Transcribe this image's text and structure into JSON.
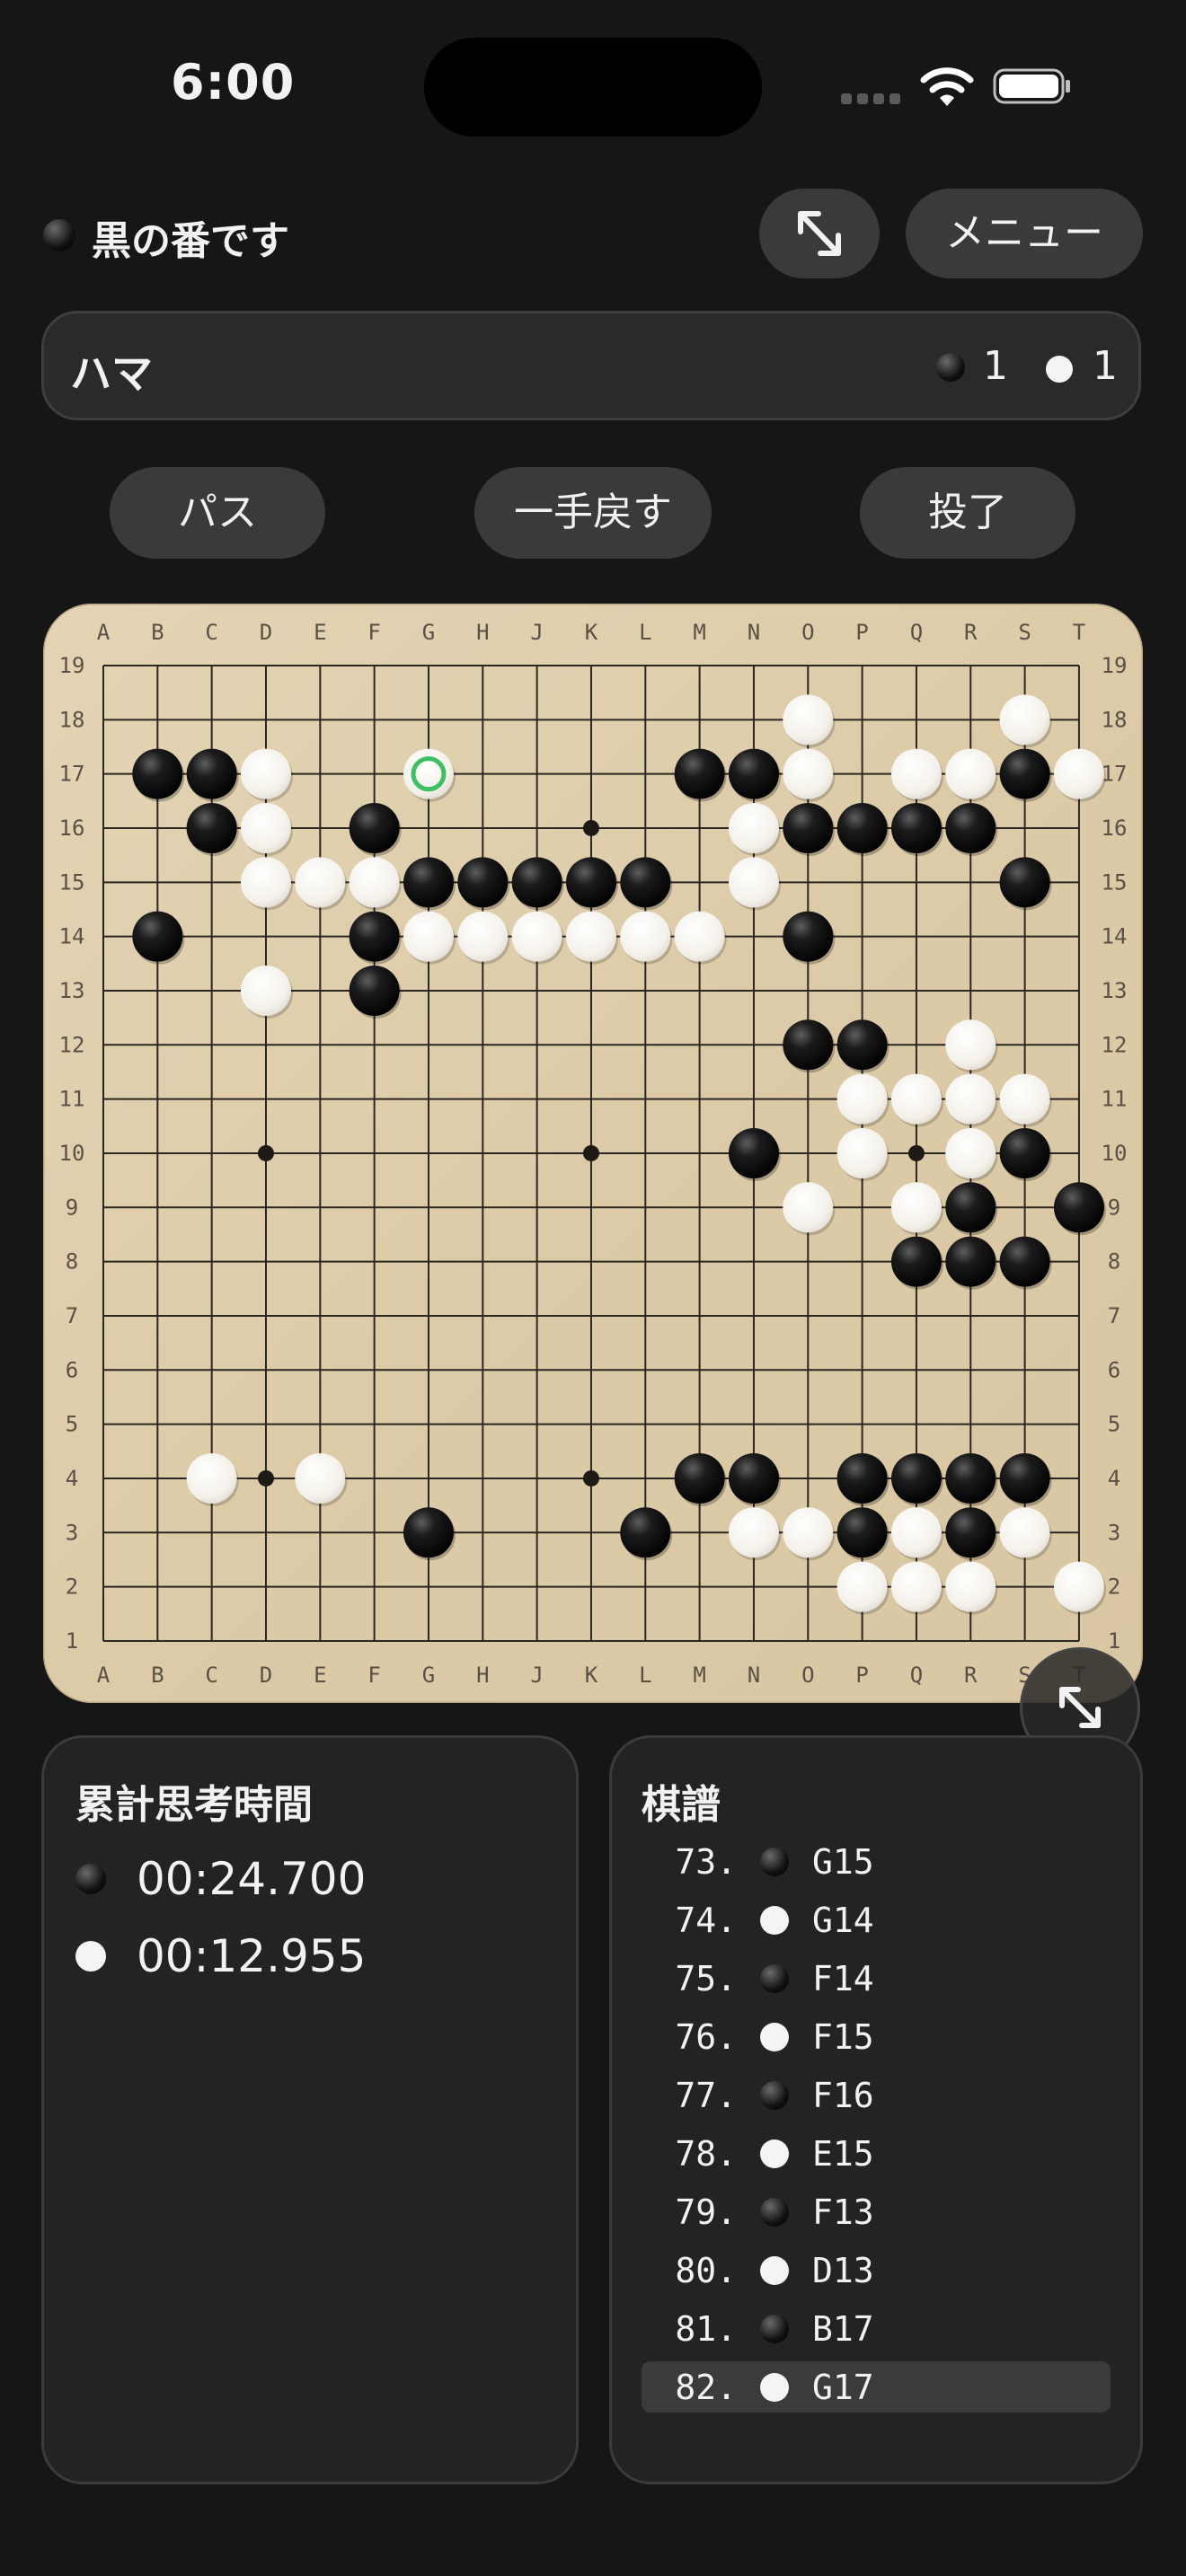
{
  "status_bar": {
    "time": "6:00"
  },
  "header": {
    "turn_text": "黒の番です",
    "turn_color": "black",
    "menu_label": "メニュー"
  },
  "hama": {
    "label": "ハマ",
    "black": "1",
    "white": "1"
  },
  "actions": {
    "pass": "パス",
    "undo": "一手戻す",
    "resign": "投了"
  },
  "board": {
    "size": 19,
    "columns": [
      "A",
      "B",
      "C",
      "D",
      "E",
      "F",
      "G",
      "H",
      "J",
      "K",
      "L",
      "M",
      "N",
      "O",
      "P",
      "Q",
      "R",
      "S",
      "T"
    ],
    "rows": [
      "19",
      "18",
      "17",
      "16",
      "15",
      "14",
      "13",
      "12",
      "11",
      "10",
      "9",
      "8",
      "7",
      "6",
      "5",
      "4",
      "3",
      "2",
      "1"
    ],
    "star_points": [
      "D16",
      "K16",
      "Q16",
      "D10",
      "K10",
      "Q10",
      "D4",
      "K4",
      "Q4"
    ],
    "last_move": "G17",
    "last_move_marker_color": "#3cc061",
    "black_stones": [
      "B17",
      "C17",
      "M17",
      "N17",
      "S17",
      "C16",
      "F16",
      "O16",
      "P16",
      "Q16",
      "R16",
      "G15",
      "H15",
      "J15",
      "K15",
      "L15",
      "S15",
      "B14",
      "F14",
      "O14",
      "F13",
      "O12",
      "P12",
      "S10",
      "N10",
      "R9",
      "T9",
      "Q8",
      "R8",
      "S8",
      "M4",
      "N4",
      "P4",
      "Q4",
      "R4",
      "S4",
      "G3",
      "L3",
      "P3",
      "R3"
    ],
    "white_stones": [
      "O18",
      "S18",
      "D17",
      "G17",
      "O17",
      "Q17",
      "R17",
      "T17",
      "D16",
      "N16",
      "D15",
      "E15",
      "F15",
      "N15",
      "G14",
      "H14",
      "J14",
      "K14",
      "L14",
      "M14",
      "D13",
      "R12",
      "P11",
      "Q11",
      "R11",
      "S11",
      "P10",
      "R10",
      "O9",
      "Q9",
      "C4",
      "E4",
      "N3",
      "O3",
      "Q3",
      "S3",
      "P2",
      "Q2",
      "R2",
      "T2"
    ]
  },
  "time_panel": {
    "title": "累計思考時間",
    "black_time": "00:24.700",
    "white_time": "00:12.955"
  },
  "record_panel": {
    "title": "棋譜",
    "moves": [
      {
        "num": "73.",
        "color": "black",
        "pos": "G15"
      },
      {
        "num": "74.",
        "color": "white",
        "pos": "G14"
      },
      {
        "num": "75.",
        "color": "black",
        "pos": "F14"
      },
      {
        "num": "76.",
        "color": "white",
        "pos": "F15"
      },
      {
        "num": "77.",
        "color": "black",
        "pos": "F16"
      },
      {
        "num": "78.",
        "color": "white",
        "pos": "E15"
      },
      {
        "num": "79.",
        "color": "black",
        "pos": "F13"
      },
      {
        "num": "80.",
        "color": "white",
        "pos": "D13"
      },
      {
        "num": "81.",
        "color": "black",
        "pos": "B17"
      },
      {
        "num": "82.",
        "color": "white",
        "pos": "G17"
      }
    ],
    "selected_index": 9
  },
  "icons": {
    "expand": "expand-arrows-icon",
    "fullscreen": "fullscreen-arrows-icon",
    "wifi": "wifi-icon",
    "battery": "battery-icon",
    "signal": "cellular-signal-icon"
  }
}
